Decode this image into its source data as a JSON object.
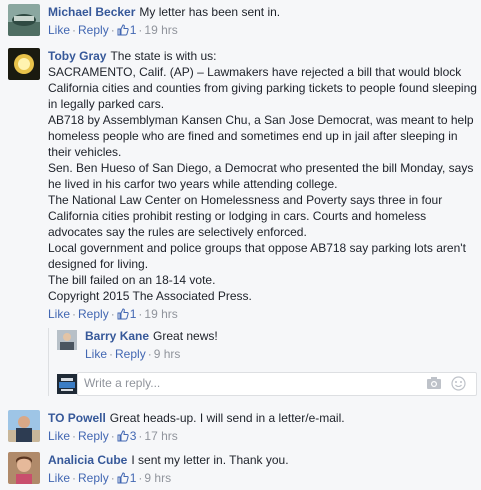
{
  "comments": [
    {
      "author": "Michael Becker",
      "text": "My letter has been sent in.",
      "actions": {
        "like": "Like",
        "reply": "Reply",
        "likes_count": "1",
        "time": "19 hrs"
      }
    },
    {
      "author": "Toby Gray",
      "first_line": "The state is with us:",
      "paragraphs": [
        "SACRAMENTO, Calif. (AP) – Lawmakers have rejected a bill that would block California cities and counties from giving parking tickets to people found sleeping in legally parked cars.",
        "AB718 by Assemblyman Kansen Chu, a San Jose Democrat, was meant to help homeless people who are fined and sometimes end up in jail after sleeping in their vehicles.",
        "Sen. Ben Hueso of San Diego, a Democrat who presented the bill Monday, says he lived in his carfor two years while attending college.",
        "The National Law Center on Homelessness and Poverty says three in four California cities prohibit resting or lodging in cars. Courts and homeless advocates say the rules are selectively enforced.",
        "Local government and police groups that oppose AB718 say parking lots aren't designed for living.",
        "The bill failed on an 18-14 vote.",
        "Copyright 2015 The Associated Press."
      ],
      "actions": {
        "like": "Like",
        "reply": "Reply",
        "likes_count": "1",
        "time": "19 hrs"
      },
      "reply": {
        "author": "Barry Kane",
        "text": "Great news!",
        "actions": {
          "like": "Like",
          "reply": "Reply",
          "time": "9 hrs"
        }
      },
      "write_reply": {
        "placeholder": "Write a reply..."
      }
    },
    {
      "author": "TO Powell",
      "text": "Great heads-up. I will send in a letter/e-mail.",
      "actions": {
        "like": "Like",
        "reply": "Reply",
        "likes_count": "3",
        "time": "17 hrs"
      }
    },
    {
      "author": "Analicia Cube",
      "text": "I sent my letter in. Thank you.",
      "actions": {
        "like": "Like",
        "reply": "Reply",
        "likes_count": "1",
        "time": "9 hrs"
      }
    }
  ],
  "colors": {
    "author": "#365899",
    "link": "#4267b2",
    "meta": "#90949c",
    "background": "#f6f7f9"
  },
  "icons": [
    "thumbs-up-icon",
    "camera-icon",
    "emoji-icon"
  ]
}
